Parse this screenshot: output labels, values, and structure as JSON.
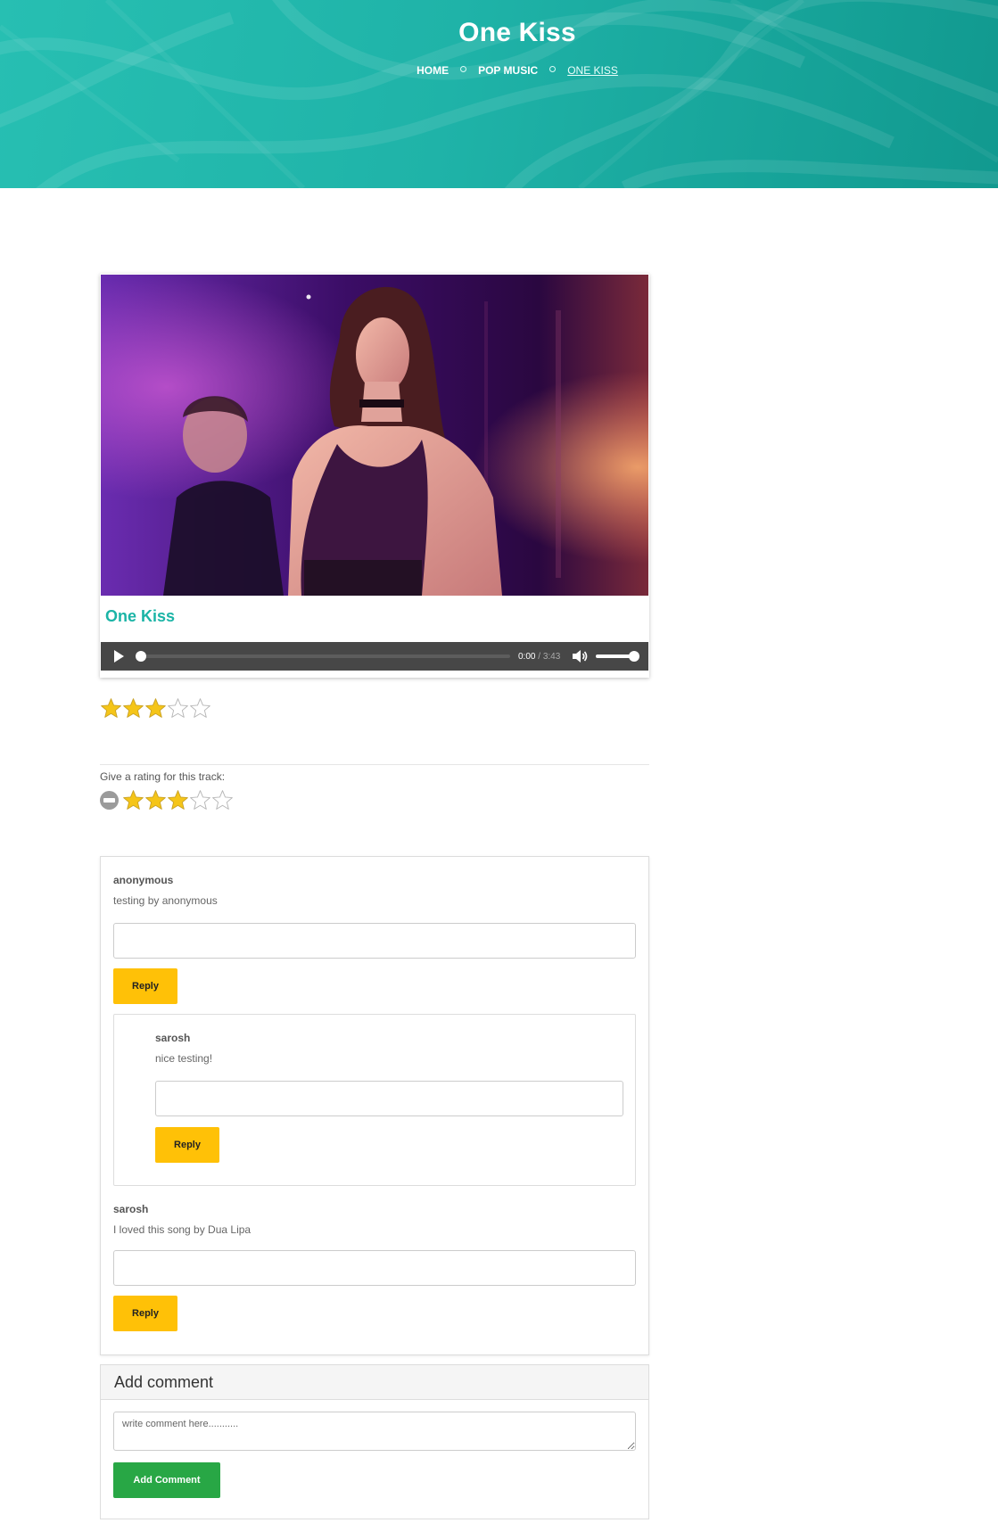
{
  "header": {
    "title": "One Kiss",
    "breadcrumb": [
      "HOME",
      "POP MUSIC",
      "ONE KISS"
    ]
  },
  "track": {
    "name": "One Kiss",
    "player": {
      "current_time": "0:00",
      "separator": " / ",
      "duration": "3:43",
      "progress_fraction": 0,
      "volume_fraction": 1
    },
    "average_rating": 3,
    "max_rating": 5
  },
  "rate": {
    "label": "Give a rating for this track:",
    "selected": 3,
    "max": 5
  },
  "comments": [
    {
      "author": "anonymous",
      "text": "testing by anonymous",
      "reply_label": "Reply",
      "replies": [
        {
          "author": "sarosh",
          "text": "nice testing!",
          "reply_label": "Reply"
        }
      ]
    },
    {
      "author": "sarosh",
      "text": "I loved this song by Dua Lipa",
      "reply_label": "Reply",
      "replies": []
    }
  ],
  "add_comment": {
    "heading": "Add comment",
    "placeholder": "write comment here...........",
    "button_label": "Add Comment"
  },
  "colors": {
    "hero": "#1fb3a8",
    "accent_text": "#1bb4a6",
    "reply_button": "#ffc107",
    "add_button": "#28a745",
    "player_bg": "#474747",
    "star_fill": "#f5c518"
  },
  "icons": {
    "play": "play-icon",
    "volume": "volume-icon",
    "star": "star-icon",
    "cancel": "cancel-rating-icon"
  }
}
